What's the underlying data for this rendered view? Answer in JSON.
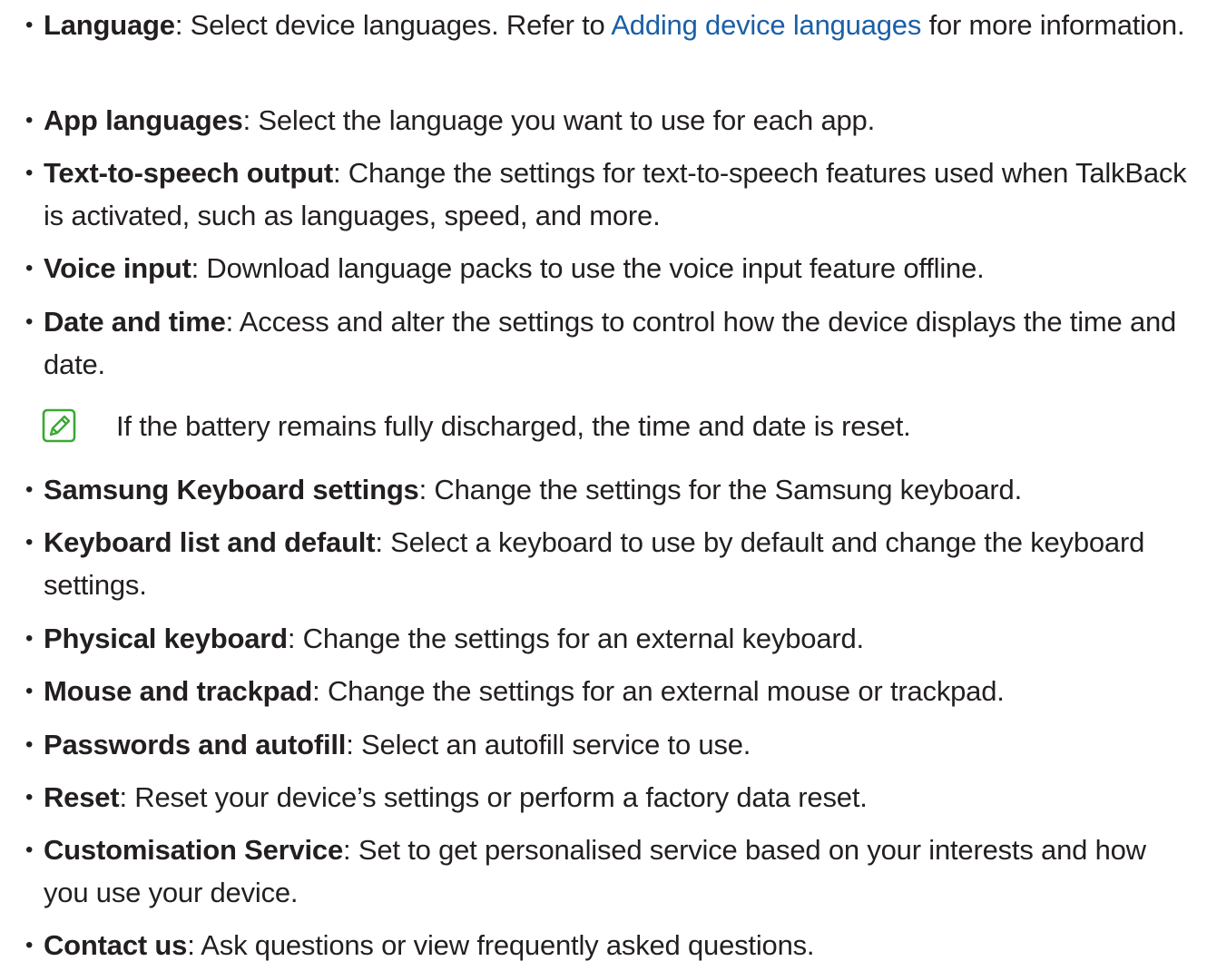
{
  "accent_color": "#1a5fa8",
  "note_icon_color": "#3aa935",
  "items": [
    {
      "label": "Language",
      "desc_before": ": Select device languages. Refer to ",
      "link": "Adding device languages",
      "desc_after": " for more information."
    },
    {
      "label": "App languages",
      "desc": ": Select the language you want to use for each app."
    },
    {
      "label": "Text-to-speech output",
      "desc": ": Change the settings for text-to-speech features used when TalkBack is activated, such as languages, speed, and more."
    },
    {
      "label": "Voice input",
      "desc": ": Download language packs to use the voice input feature offline."
    },
    {
      "label": "Date and time",
      "desc": ": Access and alter the settings to control how the device displays the time and date."
    },
    {
      "label": "Samsung Keyboard settings",
      "desc": ": Change the settings for the Samsung keyboard."
    },
    {
      "label": "Keyboard list and default",
      "desc": ": Select a keyboard to use by default and change the keyboard settings."
    },
    {
      "label": "Physical keyboard",
      "desc": ": Change the settings for an external keyboard."
    },
    {
      "label": "Mouse and trackpad",
      "desc": ": Change the settings for an external mouse or trackpad."
    },
    {
      "label": "Passwords and autofill",
      "desc": ": Select an autofill service to use."
    },
    {
      "label": "Reset",
      "desc": ": Reset your device’s settings or perform a factory data reset."
    },
    {
      "label": "Customisation Service",
      "desc": ": Set to get personalised service based on your interests and how you use your device."
    },
    {
      "label": "Contact us",
      "desc": ": Ask questions or view frequently asked questions."
    }
  ],
  "note": {
    "icon": "note-pencil-icon",
    "text": "If the battery remains fully discharged, the time and date is reset."
  }
}
